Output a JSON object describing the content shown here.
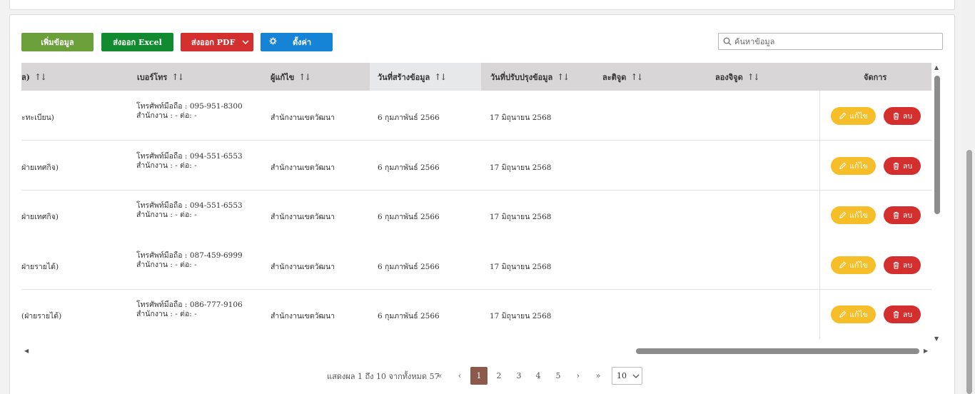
{
  "toolbar": {
    "add_label": "เพิ่มข้อมูล",
    "excel_label": "ส่งออก Excel",
    "pdf_label": "ส่งออก PDF",
    "settings_label": "ตั้งค่า"
  },
  "search": {
    "placeholder": "ค้นหาข้อมูล"
  },
  "table": {
    "columns": [
      {
        "label": "ล)"
      },
      {
        "label": "เบอร์โทร"
      },
      {
        "label": "ผู้แก้ไข"
      },
      {
        "label": "วันที่สร้างข้อมูล"
      },
      {
        "label": "วันที่ปรับปรุงข้อมูล"
      },
      {
        "label": "ละติจูด"
      },
      {
        "label": "ลองจิจูด"
      },
      {
        "label": "จัดการ"
      }
    ],
    "edit_label": "แก้ไข",
    "delete_label": "ลบ",
    "rows": [
      {
        "name": "ะทะเบียน)",
        "mobile": "โทรศัพท์มือถือ : 095-951-8300",
        "office": "สำนักงาน : - ต่อ: -",
        "editor": "สำนักงานเขตวัฒนา",
        "created": "6 กุมภาพันธ์ 2566",
        "updated": "17 มิถุนายน 2568"
      },
      {
        "name": "ฝ่ายเทศกิจ)",
        "mobile": "โทรศัพท์มือถือ : 094-551-6553",
        "office": "สำนักงาน : - ต่อ: -",
        "editor": "สำนักงานเขตวัฒนา",
        "created": "6 กุมภาพันธ์ 2566",
        "updated": "17 มิถุนายน 2568"
      },
      {
        "name": "ฝ่ายเทศกิจ)",
        "mobile": "โทรศัพท์มือถือ : 094-551-6553",
        "office": "สำนักงาน : - ต่อ: -",
        "editor": "สำนักงานเขตวัฒนา",
        "created": "6 กุมภาพันธ์ 2566",
        "updated": "17 มิถุนายน 2568"
      },
      {
        "name": "ฝ่ายรายได้)",
        "mobile": "โทรศัพท์มือถือ : 087-459-6999",
        "office": "สำนักงาน : - ต่อ: -",
        "editor": "สำนักงานเขตวัฒนา",
        "created": "6 กุมภาพันธ์ 2566",
        "updated": "17 มิถุนายน 2568"
      },
      {
        "name": "(ฝ่ายรายได้)",
        "mobile": "โทรศัพท์มือถือ : 086-777-9106",
        "office": "สำนักงาน : - ต่อ: -",
        "editor": "สำนักงานเขตวัฒนา",
        "created": "6 กุมภาพันธ์ 2566",
        "updated": "17 มิถุนายน 2568"
      }
    ]
  },
  "pagination": {
    "summary": "แสดงผล 1 ถึง 10 จากทั้งหมด 57",
    "first": "«",
    "prev": "‹",
    "pages": [
      "1",
      "2",
      "3",
      "4",
      "5"
    ],
    "active_page": "1",
    "next": "›",
    "last": "»",
    "page_size": "10"
  },
  "colors": {
    "add": "#6a9f3a",
    "excel": "#128a2f",
    "pdf": "#d32f2f",
    "settings": "#1584d6",
    "edit": "#f6be28",
    "delete": "#d32f2f",
    "active_page": "#8b5a4a"
  }
}
